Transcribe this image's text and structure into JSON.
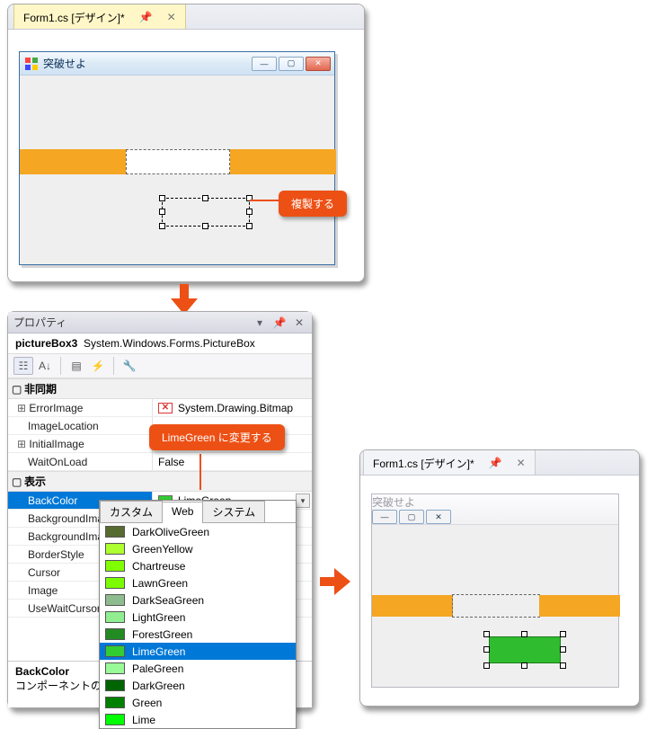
{
  "tab1": {
    "label": "Form1.cs [デザイン]*"
  },
  "win1": {
    "title": "突破せよ",
    "btn_min": "—",
    "btn_max": "▢",
    "btn_close": "✕"
  },
  "callout1": "複製する",
  "callout2_prefix": "LimeGreen",
  "callout2_suffix": " に変更する",
  "props": {
    "panelTitle": "プロパティ",
    "objectName": "pictureBox3",
    "objectType": "System.Windows.Forms.PictureBox",
    "cat_async": "非同期",
    "errorImage_n": "ErrorImage",
    "errorImage_v": "System.Drawing.Bitmap",
    "imageLocation_n": "ImageLocation",
    "initialImage_n": "InitialImage",
    "waitOnLoad_n": "WaitOnLoad",
    "waitOnLoad_v": "False",
    "cat_display": "表示",
    "backColor_n": "BackColor",
    "backColor_v": "LimeGreen",
    "backgroundImage_n": "BackgroundImage",
    "backgroundImageLayout_n": "BackgroundImageLayout",
    "borderStyle_n": "BorderStyle",
    "cursor_n": "Cursor",
    "image_n": "Image",
    "useWaitCursor_n": "UseWaitCursor",
    "desc_t": "BackColor",
    "desc_d": "コンポーネントの背景色です。"
  },
  "ddtabs": {
    "custom": "カスタム",
    "web": "Web",
    "system": "システム"
  },
  "colors": [
    {
      "name": "DarkOliveGreen",
      "hex": "#556B2F"
    },
    {
      "name": "GreenYellow",
      "hex": "#ADFF2F"
    },
    {
      "name": "Chartreuse",
      "hex": "#7FFF00"
    },
    {
      "name": "LawnGreen",
      "hex": "#7CFC00"
    },
    {
      "name": "DarkSeaGreen",
      "hex": "#8FBC8F"
    },
    {
      "name": "LightGreen",
      "hex": "#90EE90"
    },
    {
      "name": "ForestGreen",
      "hex": "#228B22"
    },
    {
      "name": "LimeGreen",
      "hex": "#32CD32"
    },
    {
      "name": "PaleGreen",
      "hex": "#98FB98"
    },
    {
      "name": "DarkGreen",
      "hex": "#006400"
    },
    {
      "name": "Green",
      "hex": "#008000"
    },
    {
      "name": "Lime",
      "hex": "#00FF00"
    }
  ],
  "tab3": {
    "label": "Form1.cs [デザイン]*"
  },
  "win3": {
    "title": "突破せよ"
  }
}
